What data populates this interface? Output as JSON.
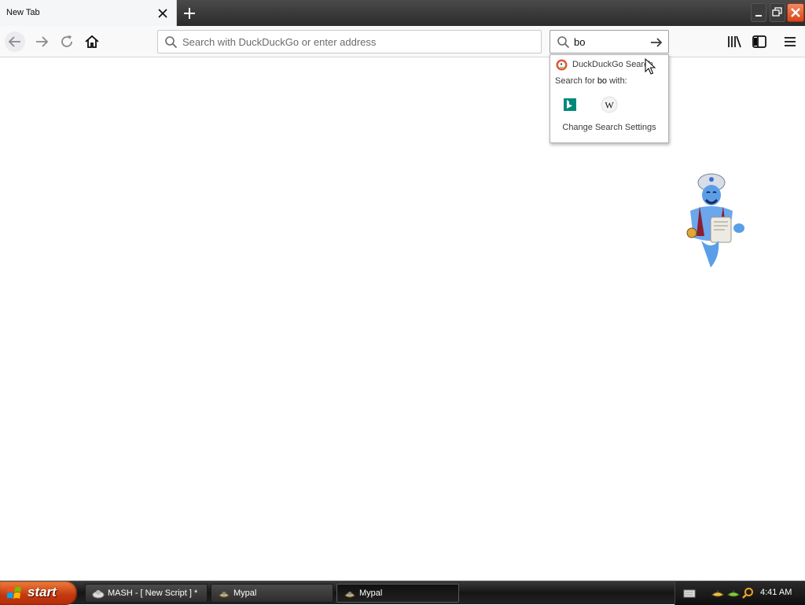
{
  "browser": {
    "tab": {
      "title": "New Tab"
    },
    "urlbar": {
      "placeholder": "Search with DuckDuckGo or enter address",
      "value": ""
    },
    "searchbar": {
      "value": "bo"
    },
    "search_popup": {
      "engine_label": "DuckDuckGo Search",
      "search_for_prefix": "Search for ",
      "search_for_query": "bo",
      "search_for_suffix": " with:",
      "alt_engines": [
        "bing-icon",
        "wikipedia-icon"
      ],
      "settings_label": "Change Search Settings"
    }
  },
  "taskbar": {
    "start_label": "start",
    "tasks": [
      {
        "label": "MASH - [ New Script ] *",
        "icon": "mash-icon",
        "active": false
      },
      {
        "label": "Mypal",
        "icon": "mypal-icon",
        "active": false
      },
      {
        "label": "Mypal",
        "icon": "mypal-icon",
        "active": true
      }
    ],
    "tray": {
      "icons": [
        "keyboard-icon",
        "genie-lamp-icon",
        "genie-lamp-icon",
        "magnifier-icon"
      ],
      "clock": "4:41 AM"
    }
  },
  "colors": {
    "start_button": "#c2370e",
    "close_button": "#d9441a",
    "bing": "#00897b",
    "duckduckgo": "#de5833"
  }
}
